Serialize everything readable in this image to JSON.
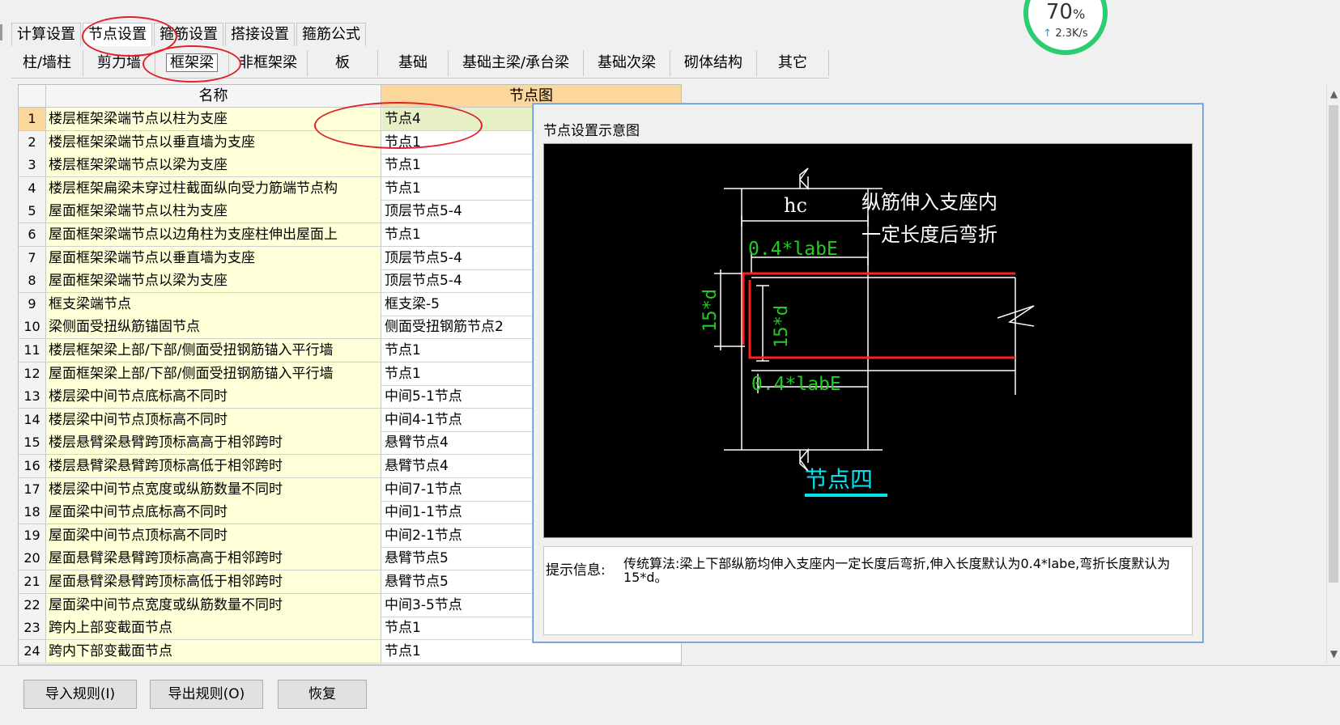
{
  "top_tabs": [
    "计算设置",
    "节点设置",
    "箍筋设置",
    "搭接设置",
    "箍筋公式"
  ],
  "active_top_tab": 1,
  "sub_tabs": [
    "柱/墙柱",
    "剪力墙",
    "框架梁",
    "非框架梁",
    "板",
    "基础",
    "基础主梁/承台梁",
    "基础次梁",
    "砌体结构",
    "其它"
  ],
  "active_sub_tab": 2,
  "grid": {
    "header_name": "名称",
    "header_value": "节点图",
    "rows": [
      {
        "n": "1",
        "name": "楼层框架梁端节点以柱为支座",
        "value": "节点4"
      },
      {
        "n": "2",
        "name": "楼层框架梁端节点以垂直墙为支座",
        "value": "节点1"
      },
      {
        "n": "3",
        "name": "楼层框架梁端节点以梁为支座",
        "value": "节点1"
      },
      {
        "n": "4",
        "name": "楼层框架扁梁未穿过柱截面纵向受力筋端节点构",
        "value": "节点1"
      },
      {
        "n": "5",
        "name": "屋面框架梁端节点以柱为支座",
        "value": "顶层节点5-4"
      },
      {
        "n": "6",
        "name": "屋面框架梁端节点以边角柱为支座柱伸出屋面上",
        "value": "节点1"
      },
      {
        "n": "7",
        "name": "屋面框架梁端节点以垂直墙为支座",
        "value": "顶层节点5-4"
      },
      {
        "n": "8",
        "name": "屋面框架梁端节点以梁为支座",
        "value": "顶层节点5-4"
      },
      {
        "n": "9",
        "name": "框支梁端节点",
        "value": "框支梁-5"
      },
      {
        "n": "10",
        "name": "梁侧面受扭纵筋锚固节点",
        "value": "侧面受扭钢筋节点2"
      },
      {
        "n": "11",
        "name": "楼层框架梁上部/下部/侧面受扭钢筋锚入平行墙",
        "value": "节点1"
      },
      {
        "n": "12",
        "name": "屋面框架梁上部/下部/侧面受扭钢筋锚入平行墙",
        "value": "节点1"
      },
      {
        "n": "13",
        "name": "楼层梁中间节点底标高不同时",
        "value": "中间5-1节点"
      },
      {
        "n": "14",
        "name": "楼层梁中间节点顶标高不同时",
        "value": "中间4-1节点"
      },
      {
        "n": "15",
        "name": "楼层悬臂梁悬臂跨顶标高高于相邻跨时",
        "value": "悬臂节点4"
      },
      {
        "n": "16",
        "name": "楼层悬臂梁悬臂跨顶标高低于相邻跨时",
        "value": "悬臂节点4"
      },
      {
        "n": "17",
        "name": "楼层梁中间节点宽度或纵筋数量不同时",
        "value": "中间7-1节点"
      },
      {
        "n": "18",
        "name": "屋面梁中间节点底标高不同时",
        "value": "中间1-1节点"
      },
      {
        "n": "19",
        "name": "屋面梁中间节点顶标高不同时",
        "value": "中间2-1节点"
      },
      {
        "n": "20",
        "name": "屋面悬臂梁悬臂跨顶标高高于相邻跨时",
        "value": "悬臂节点5"
      },
      {
        "n": "21",
        "name": "屋面悬臂梁悬臂跨顶标高低于相邻跨时",
        "value": "悬臂节点5"
      },
      {
        "n": "22",
        "name": "屋面梁中间节点宽度或纵筋数量不同时",
        "value": "中间3-5节点"
      },
      {
        "n": "23",
        "name": "跨内上部变截面节点",
        "value": "节点1"
      },
      {
        "n": "24",
        "name": "跨内下部变截面节点",
        "value": "节点1"
      }
    ]
  },
  "popup": {
    "title": "节点设置示意图",
    "diagram": {
      "hc": "hc",
      "note_line1": "纵筋伸入支座内",
      "note_line2": "一定长度后弯折",
      "top_len": "0.4*labE",
      "bottom_len": "0.4*labE",
      "outer_bend": "15*d",
      "inner_bend": "15*d",
      "caption": "节点四"
    },
    "tip_label": "提示信息:",
    "tip_text": "传统算法:梁上下部纵筋均伸入支座内一定长度后弯折,伸入长度默认为0.4*labe,弯折长度默认为15*d。"
  },
  "buttons": {
    "import": "导入规则(I)",
    "export": "导出规则(O)",
    "restore": "恢复"
  },
  "speed_widget": {
    "percent": "70",
    "percent_sign": "%",
    "rate": "2.3K/s"
  },
  "colors": {
    "red_annotation": "#e0202a",
    "diagram_green": "#22cc22",
    "diagram_red": "#ff2020",
    "caption_cyan": "#00e5ee",
    "row_name_bg": "#ffffd8",
    "selected_row_num": "#fbd79b"
  }
}
